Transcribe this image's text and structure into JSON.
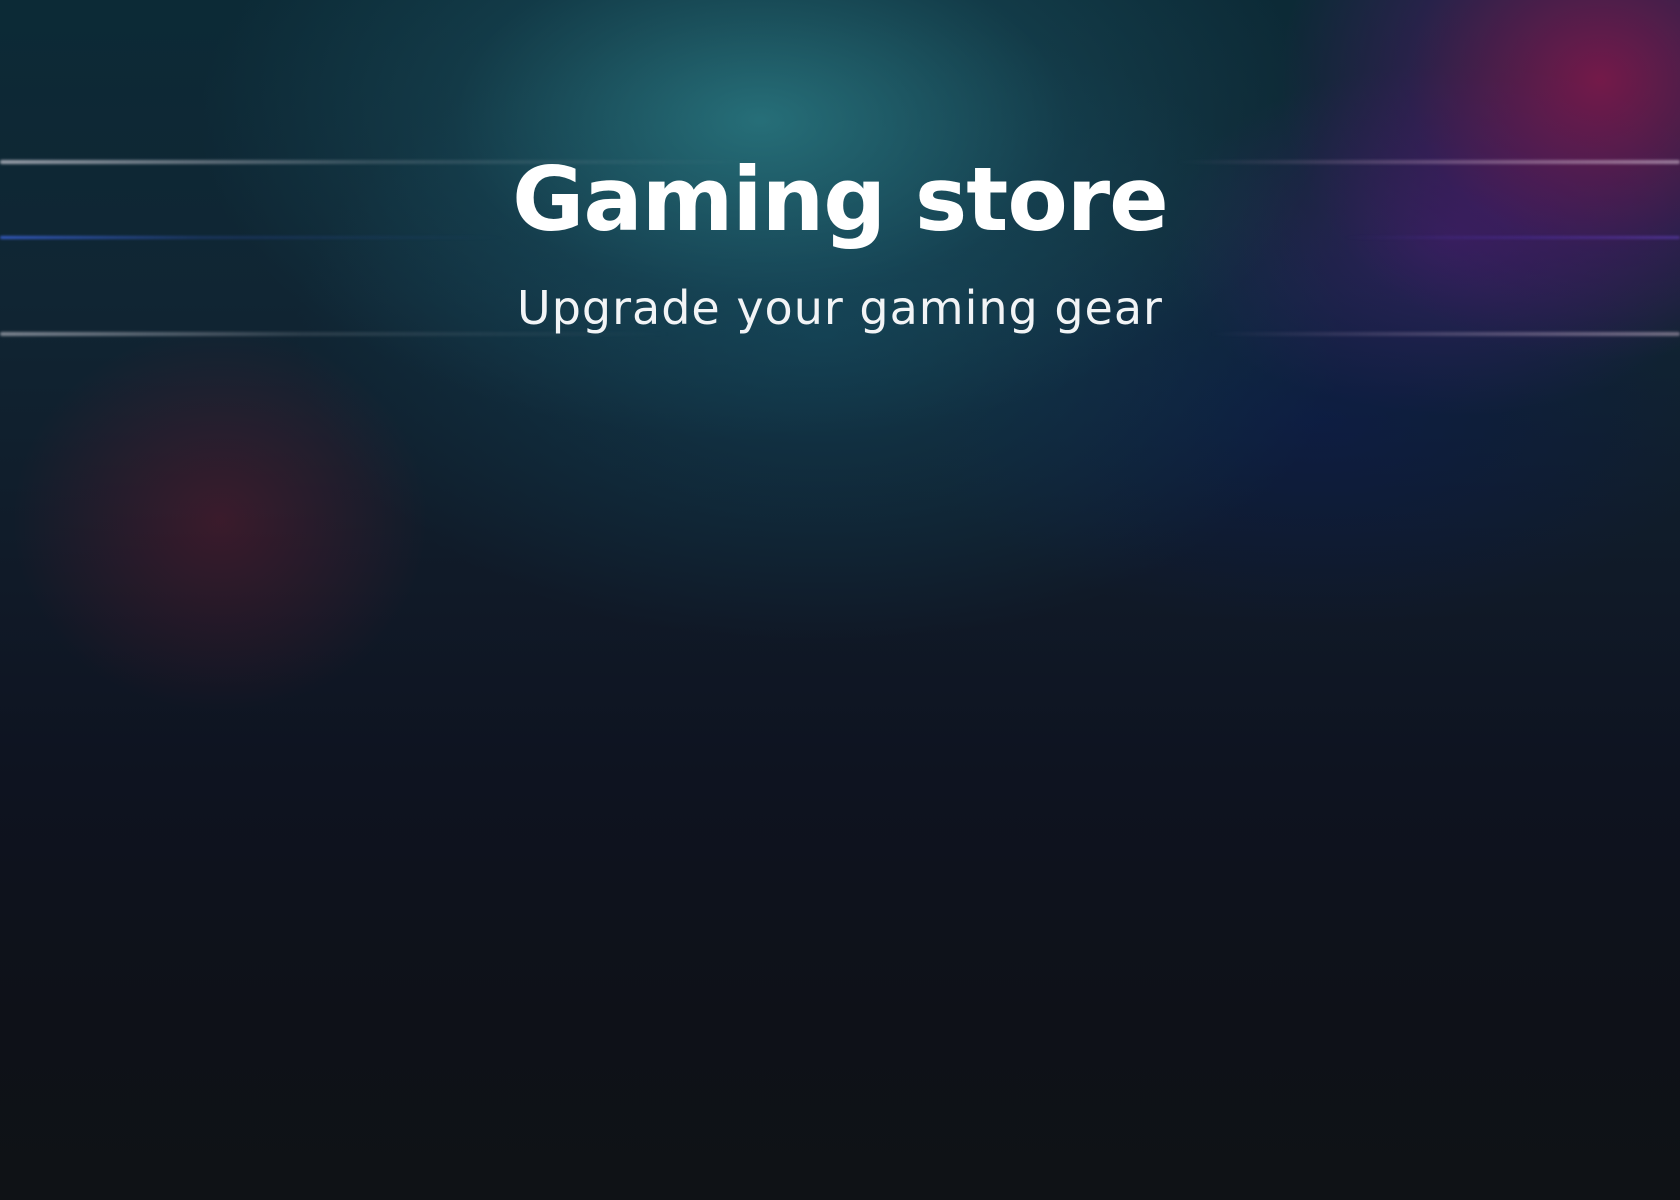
{
  "hero": {
    "title": "Gaming store",
    "subtitle": "Upgrade your gaming gear",
    "colors": {
      "title_text": "#ffffff",
      "subtitle_text": "#f2f4f6",
      "background_dark": "#0e1116",
      "glow_teal": "#2e848c",
      "glow_magenta": "#96145a"
    }
  }
}
